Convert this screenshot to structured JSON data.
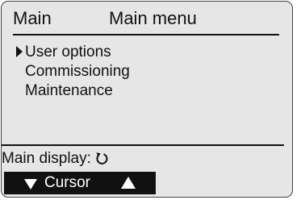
{
  "header": {
    "section": "Main",
    "title": "Main menu"
  },
  "menu": {
    "items": [
      {
        "label": "User options",
        "selected": true
      },
      {
        "label": "Commissioning",
        "selected": false
      },
      {
        "label": "Maintenance",
        "selected": false
      }
    ]
  },
  "status": {
    "label": "Main display:",
    "icon": "rotate-icon"
  },
  "softkey": {
    "label": "Cursor",
    "icons": [
      "triangle-down-icon",
      "triangle-up-icon"
    ]
  },
  "colors": {
    "lcd_background": "#e6e6e6",
    "text": "#111111",
    "softkey_background": "#111111",
    "softkey_text": "#ffffff"
  }
}
